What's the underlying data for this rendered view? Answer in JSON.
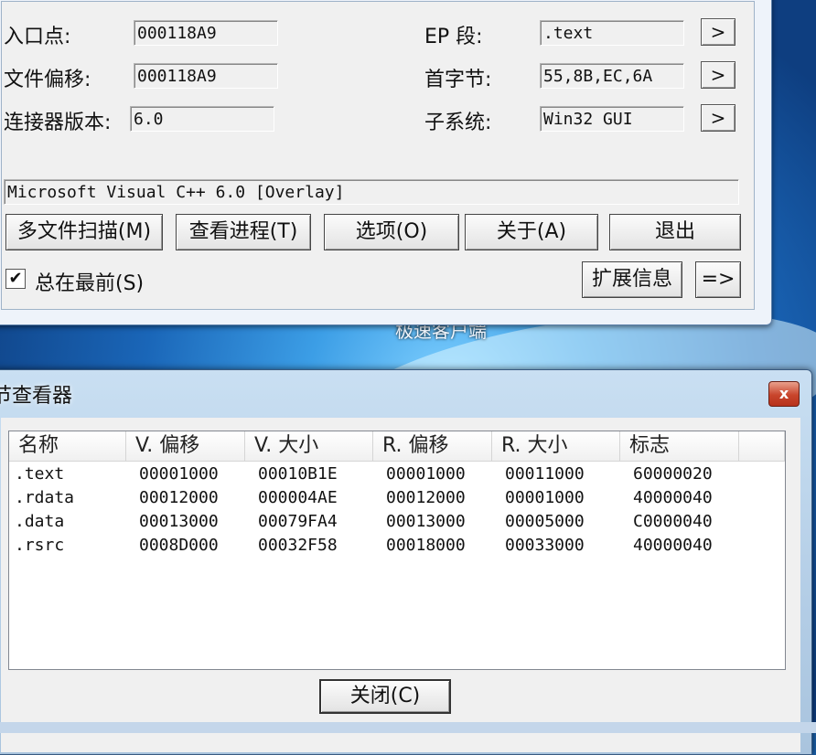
{
  "desktop": {
    "caption": "极速客户端"
  },
  "main": {
    "rows_left": [
      {
        "label": "入口点:",
        "value": "000118A9"
      },
      {
        "label": "文件偏移:",
        "value": "000118A9"
      },
      {
        "label": "连接器版本:",
        "value": "6.0"
      }
    ],
    "rows_right": [
      {
        "label": "EP 段:",
        "value": ".text",
        "button": ">"
      },
      {
        "label": "首字节:",
        "value": "55,8B,EC,6A",
        "button": ">"
      },
      {
        "label": "子系统:",
        "value": "Win32 GUI",
        "button": ">"
      }
    ],
    "detect_result": "Microsoft Visual C++ 6.0 [Overlay]",
    "buttons": {
      "multi_scan": "多文件扫描(M)",
      "view_process": "查看进程(T)",
      "options": "选项(O)",
      "about": "关于(A)",
      "exit": "退出"
    },
    "always_on_top": {
      "label": "总在最前(S)",
      "checked_glyph": "✔"
    },
    "ext_info": "扩展信息",
    "more": "=>"
  },
  "section_viewer": {
    "title": "节查看器",
    "close_glyph": "x",
    "columns": [
      "名称",
      "V. 偏移",
      "V. 大小",
      "R. 偏移",
      "R. 大小",
      "标志"
    ],
    "rows": [
      [
        ".text",
        "00001000",
        "00010B1E",
        "00001000",
        "00011000",
        "60000020"
      ],
      [
        ".rdata",
        "00012000",
        "000004AE",
        "00012000",
        "00001000",
        "40000040"
      ],
      [
        ".data",
        "00013000",
        "00079FA4",
        "00013000",
        "00005000",
        "C0000040"
      ],
      [
        ".rsrc",
        "0008D000",
        "00032F58",
        "00018000",
        "00033000",
        "40000040"
      ]
    ],
    "close_button": "关闭(C)"
  }
}
